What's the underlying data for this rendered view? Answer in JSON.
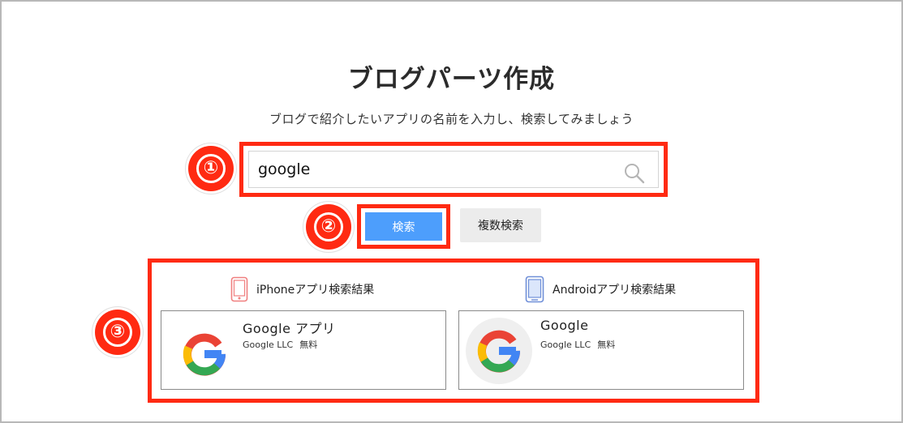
{
  "page": {
    "title": "ブログパーツ作成",
    "subtitle": "ブログで紹介したいアプリの名前を入力し、検索してみましょう"
  },
  "annotations": {
    "step1": "①",
    "step2": "②",
    "step3": "③"
  },
  "search": {
    "value": "google",
    "icon": "search-icon"
  },
  "buttons": {
    "search_label": "検索",
    "multi_search_label": "複数検索"
  },
  "results": {
    "iphone": {
      "heading": "iPhoneアプリ検索結果",
      "icon": "iphone-icon",
      "card": {
        "name": "Google アプリ",
        "developer": "Google LLC",
        "price": "無料"
      }
    },
    "android": {
      "heading": "Androidアプリ検索結果",
      "icon": "android-phone-icon",
      "card": {
        "name": "Google",
        "developer": "Google LLC",
        "price": "無料"
      }
    }
  },
  "colors": {
    "annotation_red": "#ff2a12",
    "search_button": "#4d9efc",
    "multi_button": "#ececec",
    "iphone_icon": "#f08080",
    "android_icon": "#6f8fd8"
  }
}
